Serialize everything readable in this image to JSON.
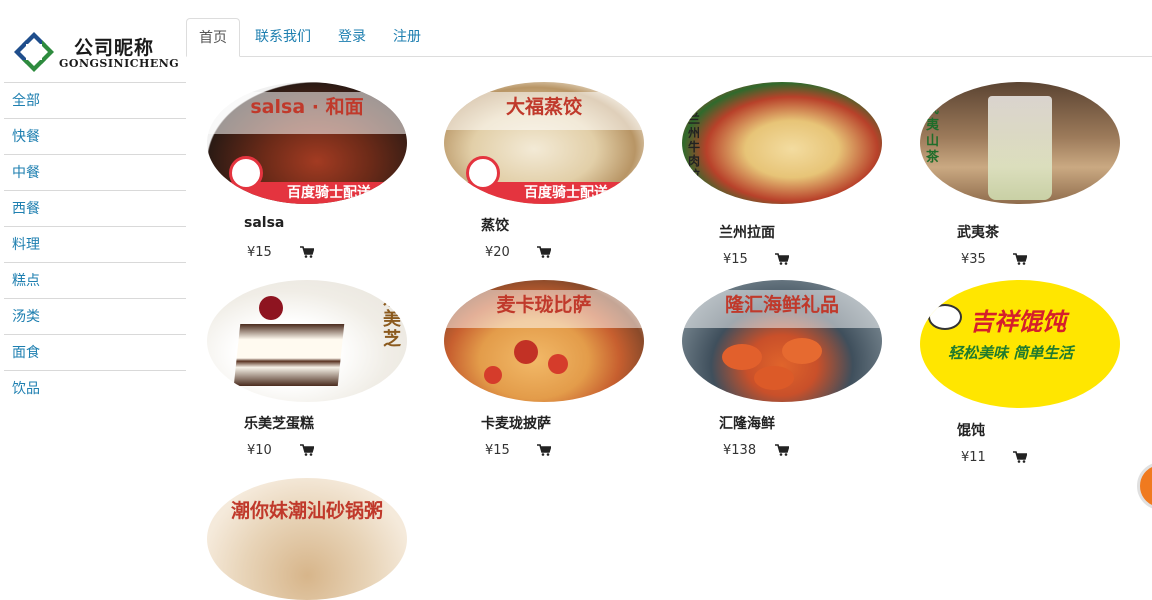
{
  "brand": {
    "name_cn": "公司昵称",
    "name_en": "GONGSINICHENG"
  },
  "sidebar": {
    "items": [
      {
        "label": "全部"
      },
      {
        "label": "快餐"
      },
      {
        "label": "中餐"
      },
      {
        "label": "西餐"
      },
      {
        "label": "料理"
      },
      {
        "label": "糕点"
      },
      {
        "label": "汤类"
      },
      {
        "label": "面食"
      },
      {
        "label": "饮品"
      }
    ]
  },
  "tabs": [
    {
      "label": "首页",
      "active": true
    },
    {
      "label": "联系我们"
    },
    {
      "label": "登录"
    },
    {
      "label": "注册"
    }
  ],
  "products": [
    {
      "image_caption": "salsa · 和面",
      "image_sub": "百度骑士配送",
      "name": "salsa",
      "price": "¥15"
    },
    {
      "image_caption": "大福蒸饺",
      "image_sub": "百度骑士配送",
      "name": "蒸饺",
      "price": "¥20"
    },
    {
      "image_caption": "兰州牛肉拉",
      "image_sub": "",
      "name": "兰州拉面",
      "price": "¥15"
    },
    {
      "image_caption": "武夷山茶",
      "image_sub": "",
      "name": "武夷茶",
      "price": "¥35"
    },
    {
      "image_caption": "乐美芝",
      "image_sub": "",
      "name": "乐美芝蛋糕",
      "price": "¥10"
    },
    {
      "image_caption": "麦卡珑比萨",
      "image_sub": "",
      "name": "卡麦珑披萨",
      "price": "¥15"
    },
    {
      "image_caption": "隆汇海鲜礼品",
      "image_sub": "",
      "name": "汇隆海鲜",
      "price": "¥138"
    },
    {
      "image_caption": "吉祥馄饨",
      "image_sub": "轻松美味 简单生活",
      "name": "馄饨",
      "price": "¥11"
    },
    {
      "image_caption": "潮你妹潮汕砂锅粥",
      "image_sub": "",
      "name": "",
      "price": ""
    }
  ],
  "colors": {
    "link": "#1e7fb0",
    "accent": "#c0392b",
    "badge": "#f07a1f"
  }
}
